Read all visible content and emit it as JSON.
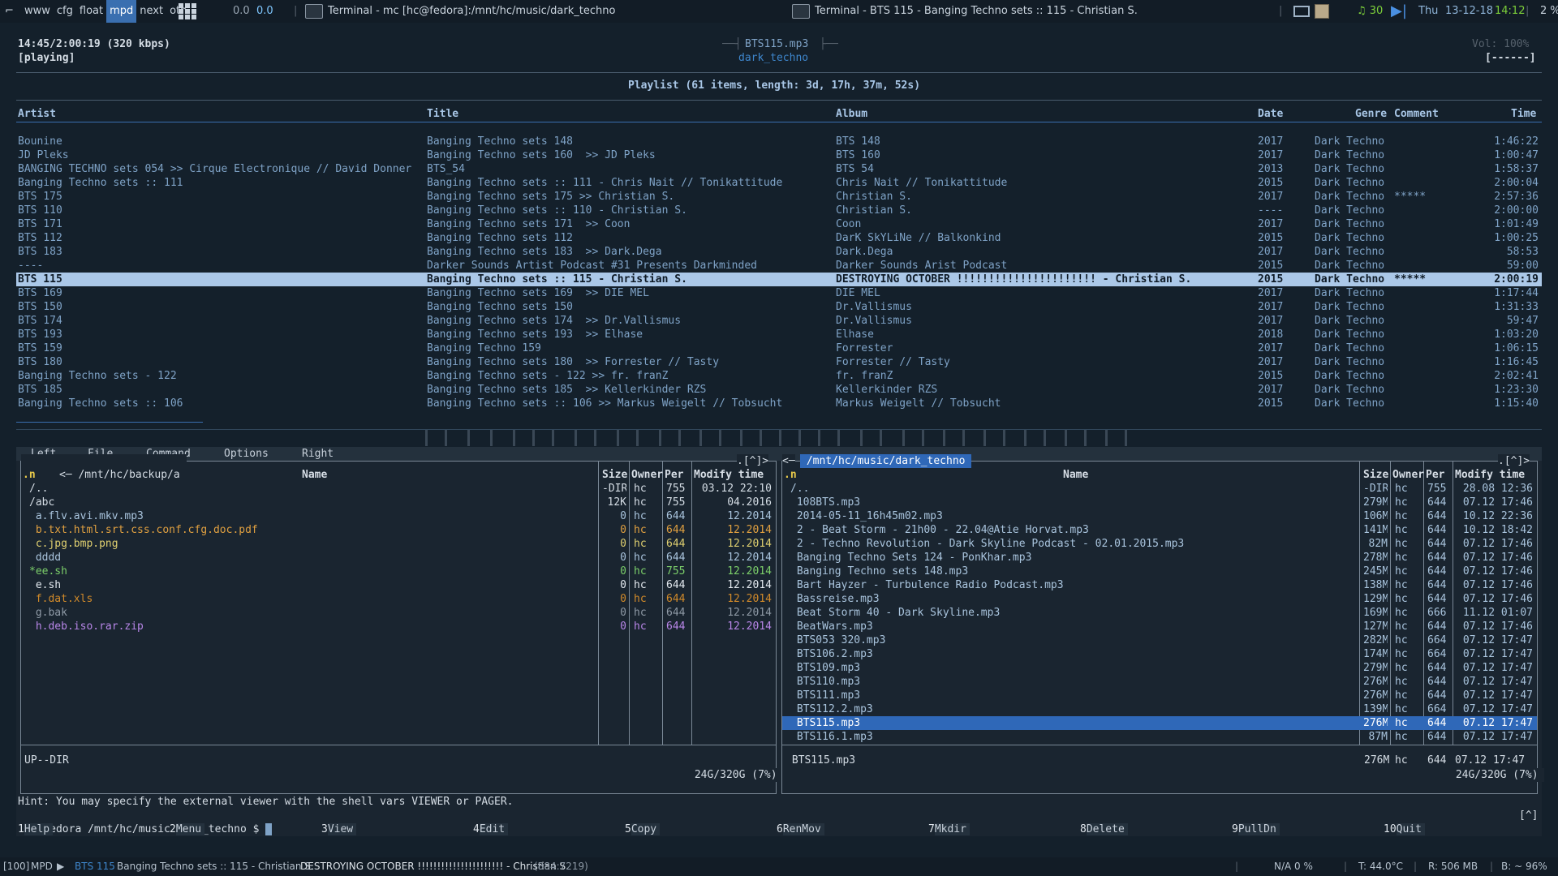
{
  "topbar": {
    "workspaces": [
      "www",
      "cfg",
      "float",
      "mpd",
      "next",
      "oth"
    ],
    "load": "0.0",
    "load2": "0.0",
    "window1_title": "Terminal - mc [hc@fedora]:/mnt/hc/music/dark_techno",
    "window2_title": "Terminal - BTS 115 - Banging Techno sets :: 115 - Christian S.",
    "volume": "♫ 30",
    "day": "Thu",
    "date": "13-12-18",
    "time": "14:12",
    "cpu": "2 %"
  },
  "ncmpcpp": {
    "elapsed": "14:45/2:00:19 (320 kbps)",
    "state": "[playing]",
    "current_title": "BTS115.mp3",
    "current_dir": "dark_techno",
    "volume": "Vol: 100%",
    "flags": "[------]",
    "playlist_header": "Playlist (61 items, length: 3d, 17h, 37m, 52s)",
    "columns": {
      "artist": "Artist",
      "title": "Title",
      "album": "Album",
      "date": "Date",
      "genre": "Genre",
      "comment": "Comment",
      "time": "Time"
    },
    "tracks": [
      {
        "artist": "Bounine",
        "title": "Banging Techno sets 148",
        "album": "BTS 148",
        "date": "2017",
        "genre": "Dark Techno",
        "comment": "",
        "time": "1:46:22"
      },
      {
        "artist": "JD Pleks",
        "title": "Banging Techno sets 160  >> JD Pleks",
        "album": "BTS 160",
        "date": "2017",
        "genre": "Dark Techno",
        "comment": "",
        "time": "1:00:47"
      },
      {
        "artist": "BANGING TECHNO sets 054 >> Cirque Electronique // David Donner",
        "title": "BTS_54",
        "album": "BTS 54",
        "date": "2013",
        "genre": "Dark Techno",
        "comment": "",
        "time": "1:58:37"
      },
      {
        "artist": "Banging Techno sets :: 111",
        "title": "Banging Techno sets :: 111 - Chris Nait // Tonikattitude",
        "album": "Chris Nait // Tonikattitude",
        "date": "2015",
        "genre": "Dark Techno",
        "comment": "",
        "time": "2:00:04"
      },
      {
        "artist": "BTS 175",
        "title": "Banging Techno sets 175 >> Christian S.",
        "album": "Christian S.",
        "date": "2017",
        "genre": "Dark Techno",
        "comment": "*****",
        "time": "2:57:36"
      },
      {
        "artist": "BTS 110",
        "title": "Banging Techno sets :: 110 - Christian S.",
        "album": "Christian S.",
        "date": "----",
        "genre": "Dark Techno",
        "comment": "",
        "time": "2:00:00"
      },
      {
        "artist": "BTS 171",
        "title": "Banging Techno sets 171  >> Coon",
        "album": "Coon",
        "date": "2017",
        "genre": "Dark Techno",
        "comment": "",
        "time": "1:01:49"
      },
      {
        "artist": "BTS 112",
        "title": "Banging Techno sets 112",
        "album": "DarK SkYLiNe // Balkonkind",
        "date": "2015",
        "genre": "Dark Techno",
        "comment": "",
        "time": "1:00:25"
      },
      {
        "artist": "BTS 183",
        "title": "Banging Techno sets 183  >> Dark.Dega",
        "album": "Dark.Dega",
        "date": "2017",
        "genre": "Dark Techno",
        "comment": "",
        "time": "58:53"
      },
      {
        "artist": "----",
        "title": "Darker Sounds Artist Podcast #31 Presents Darkminded",
        "album": "Darker Sounds Arist Podcast",
        "date": "2015",
        "genre": "Dark Techno",
        "comment": "",
        "time": "59:00"
      },
      {
        "artist": "BTS 115",
        "title": "Banging Techno sets :: 115 - Christian S.",
        "album": "DESTROYING OCTOBER !!!!!!!!!!!!!!!!!!!!!! - Christian S.",
        "date": "2015",
        "genre": "Dark Techno",
        "comment": "*****",
        "time": "2:00:19"
      },
      {
        "artist": "BTS 169",
        "title": "Banging Techno sets 169  >> DIE MEL",
        "album": "DIE MEL",
        "date": "2017",
        "genre": "Dark Techno",
        "comment": "",
        "time": "1:17:44"
      },
      {
        "artist": "BTS 150",
        "title": "Banging Techno sets 150",
        "album": "Dr.Vallismus",
        "date": "2017",
        "genre": "Dark Techno",
        "comment": "",
        "time": "1:31:33"
      },
      {
        "artist": "BTS 174",
        "title": "Banging Techno sets 174  >> Dr.Vallismus",
        "album": "Dr.Vallismus",
        "date": "2017",
        "genre": "Dark Techno",
        "comment": "",
        "time": "59:47"
      },
      {
        "artist": "BTS 193",
        "title": "Banging Techno sets 193  >> Elhase",
        "album": "Elhase",
        "date": "2018",
        "genre": "Dark Techno",
        "comment": "",
        "time": "1:03:20"
      },
      {
        "artist": "BTS 159",
        "title": "Banging Techno 159",
        "album": "Forrester",
        "date": "2017",
        "genre": "Dark Techno",
        "comment": "",
        "time": "1:06:15"
      },
      {
        "artist": "BTS 180",
        "title": "Banging Techno sets 180  >> Forrester // Tasty",
        "album": "Forrester // Tasty",
        "date": "2017",
        "genre": "Dark Techno",
        "comment": "",
        "time": "1:16:45"
      },
      {
        "artist": "Banging Techno sets - 122",
        "title": "Banging Techno sets - 122 >> fr. franZ",
        "album": "fr. franZ",
        "date": "2015",
        "genre": "Dark Techno",
        "comment": "",
        "time": "2:02:41"
      },
      {
        "artist": "BTS 185",
        "title": "Banging Techno sets 185  >> Kellerkinder RZS",
        "album": "Kellerkinder RZS",
        "date": "2017",
        "genre": "Dark Techno",
        "comment": "",
        "time": "1:23:30"
      },
      {
        "artist": "Banging Techno sets :: 106",
        "title": "Banging Techno sets :: 106 >> Markus Weigelt // Tobsucht",
        "album": "Markus Weigelt // Tobsucht",
        "date": "2015",
        "genre": "Dark Techno",
        "comment": "",
        "time": "1:15:40"
      }
    ],
    "selected_index": 10
  },
  "mc": {
    "menu": [
      "Left",
      "File",
      "Command",
      "Options",
      "Right"
    ],
    "left": {
      "path": " /mnt/hc/backup/a ",
      "cols": {
        "sort": ".n",
        "name": "Name",
        "size": "Size",
        "owner": "Owner",
        "perm": "Per",
        "mtime": "Modify time"
      },
      "rows": [
        {
          "name": "/..",
          "size": "-DIR",
          "owner": "hc",
          "perm": "755",
          "mtime": "03.12 22:10",
          "color": "#d5dde5"
        },
        {
          "name": "/abc",
          "size": "12K",
          "owner": "hc",
          "perm": "755",
          "mtime": "04.2016",
          "color": "#d5dde5"
        },
        {
          "name": " a.flv.avi.mkv.mp3",
          "size": "0",
          "owner": "hc",
          "perm": "644",
          "mtime": "12.2014",
          "color": "#a9c4dd"
        },
        {
          "name": " b.txt.html.srt.css.conf.cfg.doc.pdf",
          "size": "0",
          "owner": "hc",
          "perm": "644",
          "mtime": "12.2014",
          "color": "#e0a040"
        },
        {
          "name": " c.jpg.bmp.png",
          "size": "0",
          "owner": "hc",
          "perm": "644",
          "mtime": "12.2014",
          "color": "#e0d070"
        },
        {
          "name": " dddd",
          "size": "0",
          "owner": "hc",
          "perm": "644",
          "mtime": "12.2014",
          "color": "#a9c4dd"
        },
        {
          "name": "*ee.sh",
          "size": "0",
          "owner": "hc",
          "perm": "755",
          "mtime": "12.2014",
          "color": "#7ccf6a"
        },
        {
          "name": " e.sh",
          "size": "0",
          "owner": "hc",
          "perm": "644",
          "mtime": "12.2014",
          "color": "#e3e9ef"
        },
        {
          "name": " f.dat.xls",
          "size": "0",
          "owner": "hc",
          "perm": "644",
          "mtime": "12.2014",
          "color": "#d18a2a"
        },
        {
          "name": " g.bak",
          "size": "0",
          "owner": "hc",
          "perm": "644",
          "mtime": "12.2014",
          "color": "#8f9aa6"
        },
        {
          "name": " h.deb.iso.rar.zip",
          "size": "0",
          "owner": "hc",
          "perm": "644",
          "mtime": "12.2014",
          "color": "#b886e8"
        }
      ],
      "status": "UP--DIR",
      "disk": " 24G/320G (7%) "
    },
    "right": {
      "path": " /mnt/hc/music/dark_techno ",
      "cols": {
        "sort": ".n",
        "name": "Name",
        "size": "Size",
        "owner": "Owner",
        "perm": "Per",
        "mtime": "Modify time"
      },
      "rows": [
        {
          "name": "/..",
          "size": "-DIR",
          "owner": "hc",
          "perm": "755",
          "mtime": "28.08 12:36"
        },
        {
          "name": " 108BTS.mp3",
          "size": "279M",
          "owner": "hc",
          "perm": "644",
          "mtime": "07.12 17:46"
        },
        {
          "name": " 2014-05-11_16h45m02.mp3",
          "size": "106M",
          "owner": "hc",
          "perm": "644",
          "mtime": "10.12 22:36"
        },
        {
          "name": " 2 - Beat Storm - 21h00 - 22.04@Atie Horvat.mp3",
          "size": "141M",
          "owner": "hc",
          "perm": "644",
          "mtime": "10.12 18:42"
        },
        {
          "name": " 2 - Techno Revolution - Dark Skyline Podcast - 02.01.2015.mp3",
          "size": "82M",
          "owner": "hc",
          "perm": "644",
          "mtime": "07.12 17:46"
        },
        {
          "name": " Banging Techno Sets 124 - PonKhar.mp3",
          "size": "278M",
          "owner": "hc",
          "perm": "644",
          "mtime": "07.12 17:46"
        },
        {
          "name": " Banging Techno sets 148.mp3",
          "size": "245M",
          "owner": "hc",
          "perm": "644",
          "mtime": "07.12 17:46"
        },
        {
          "name": " Bart Hayzer - Turbulence Radio Podcast.mp3",
          "size": "138M",
          "owner": "hc",
          "perm": "644",
          "mtime": "07.12 17:46"
        },
        {
          "name": " Bassreise.mp3",
          "size": "129M",
          "owner": "hc",
          "perm": "644",
          "mtime": "07.12 17:46"
        },
        {
          "name": " Beat Storm 40 - Dark Skyline.mp3",
          "size": "169M",
          "owner": "hc",
          "perm": "666",
          "mtime": "11.12 01:07"
        },
        {
          "name": " BeatWars.mp3",
          "size": "127M",
          "owner": "hc",
          "perm": "644",
          "mtime": "07.12 17:46"
        },
        {
          "name": " BTS053 320.mp3",
          "size": "282M",
          "owner": "hc",
          "perm": "664",
          "mtime": "07.12 17:47"
        },
        {
          "name": " BTS106.2.mp3",
          "size": "174M",
          "owner": "hc",
          "perm": "664",
          "mtime": "07.12 17:47"
        },
        {
          "name": " BTS109.mp3",
          "size": "279M",
          "owner": "hc",
          "perm": "644",
          "mtime": "07.12 17:47"
        },
        {
          "name": " BTS110.mp3",
          "size": "276M",
          "owner": "hc",
          "perm": "644",
          "mtime": "07.12 17:47"
        },
        {
          "name": " BTS111.mp3",
          "size": "276M",
          "owner": "hc",
          "perm": "644",
          "mtime": "07.12 17:47"
        },
        {
          "name": " BTS112.2.mp3",
          "size": "139M",
          "owner": "hc",
          "perm": "664",
          "mtime": "07.12 17:47"
        },
        {
          "name": " BTS115.mp3",
          "size": "276M",
          "owner": "hc",
          "perm": "644",
          "mtime": "07.12 17:47"
        },
        {
          "name": " BTS116.1.mp3",
          "size": "87M",
          "owner": "hc",
          "perm": "644",
          "mtime": "07.12 17:47"
        }
      ],
      "selected_index": 17,
      "status_name": " BTS115.mp3",
      "status_size": "276M",
      "status_owner": "hc",
      "status_perm": "644",
      "status_mtime": "07.12 17:47",
      "disk": " 24G/320G (7%) "
    },
    "hint": "Hint: You may specify the external viewer with the shell vars VIEWER or PAGER.",
    "prompt": "fedora /mnt/hc/music/dark_techno $ ",
    "prompt_flag": "[^]",
    "fkeys": [
      {
        "n": "1",
        "l": "Help"
      },
      {
        "n": "2",
        "l": "Menu"
      },
      {
        "n": "3",
        "l": "View"
      },
      {
        "n": "4",
        "l": "Edit"
      },
      {
        "n": "5",
        "l": "Copy"
      },
      {
        "n": "6",
        "l": "RenMov"
      },
      {
        "n": "7",
        "l": "Mkdir"
      },
      {
        "n": "8",
        "l": "Delete"
      },
      {
        "n": "9",
        "l": "PullDn"
      },
      {
        "n": "10",
        "l": "Quit"
      }
    ]
  },
  "bottombar": {
    "mpd_count": "[100]",
    "mpd_label": "MPD",
    "play_icon": "▶",
    "track_artist": "BTS 115",
    "track_title": "Banging Techno sets :: 115 - Christian S.",
    "track_album": "DESTROYING OCTOBER !!!!!!!!!!!!!!!!!!!!!! - Christian S.",
    "pos": "(884:7219)",
    "net": "N/A 0 %",
    "temp": "T: 44.0°C",
    "ram": "R: 506 MB",
    "battery": "B: ~ 96%"
  },
  "colors": {
    "accent": "#3a6fb0",
    "bg": "#14202b",
    "text": "#7fa3c7",
    "header": "#a8c6e6",
    "selected_row": "#abc8e8"
  }
}
